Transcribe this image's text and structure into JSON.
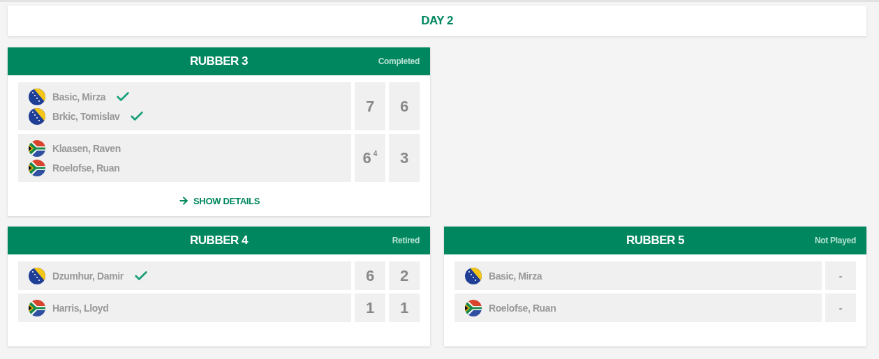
{
  "day": {
    "title": "DAY 2"
  },
  "rubbers": [
    {
      "title": "RUBBER 3",
      "status": "Completed",
      "link": "SHOW DETAILS",
      "teams": [
        {
          "kind": "bih",
          "players": [
            {
              "name": "Basic, Mirza",
              "winner": true
            },
            {
              "name": "Brkic, Tomislav",
              "winner": true
            }
          ],
          "scores": [
            "7",
            "6"
          ]
        },
        {
          "kind": "rsa",
          "players": [
            {
              "name": "Klaasen, Raven",
              "winner": false
            },
            {
              "name": "Roelofse, Ruan",
              "winner": false
            }
          ],
          "scores": [
            "6$^{4}$",
            "3"
          ]
        }
      ]
    },
    {
      "title": "RUBBER 4",
      "status": "Retired",
      "teams": [
        {
          "kind": "bih",
          "players": [
            {
              "name": "Dzumhur, Damir",
              "winner": true
            }
          ],
          "scores": [
            "6",
            "2"
          ]
        },
        {
          "kind": "rsa",
          "players": [
            {
              "name": "Harris, Lloyd",
              "winner": false
            }
          ],
          "scores": [
            "1",
            "1"
          ]
        }
      ]
    },
    {
      "title": "RUBBER 5",
      "status": "Not Played",
      "teams": [
        {
          "kind": "bih",
          "players": [
            {
              "name": "Basic, Mirza",
              "winner": false
            }
          ],
          "scores": [
            "-"
          ]
        },
        {
          "kind": "rsa",
          "players": [
            {
              "name": "Roelofse, Ruan",
              "winner": false
            }
          ],
          "scores": [
            "-"
          ]
        }
      ]
    }
  ]
}
